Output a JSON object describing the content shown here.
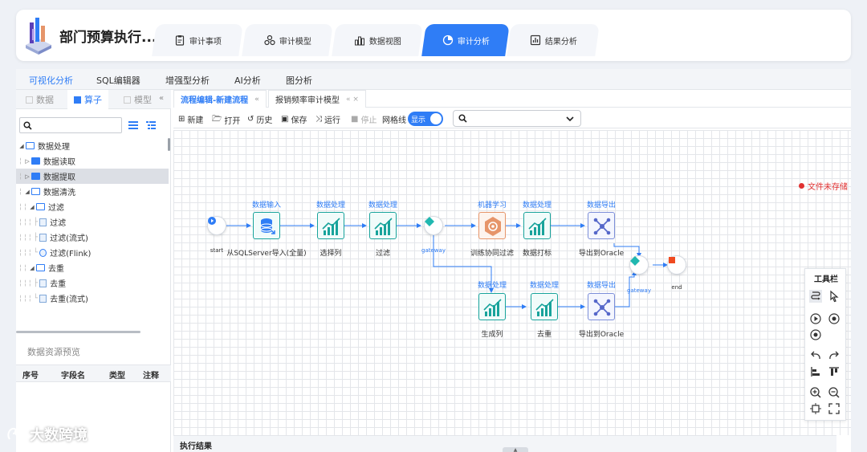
{
  "app": {
    "title": "部门预算执行..."
  },
  "nav_tabs": [
    {
      "label": "审计事项",
      "icon": "clipboard-icon"
    },
    {
      "label": "审计模型",
      "icon": "model-icon"
    },
    {
      "label": "数据视图",
      "icon": "bar-chart-icon"
    },
    {
      "label": "审计分析",
      "icon": "pie-chart-icon",
      "active": true
    },
    {
      "label": "结果分析",
      "icon": "report-icon"
    }
  ],
  "sub_tabs": [
    "可视化分析",
    "SQL编辑器",
    "增强型分析",
    "AI分析",
    "图分析"
  ],
  "left_tabs": [
    "数据",
    "算子",
    "模型"
  ],
  "tree": [
    {
      "label": "数据处理",
      "level": 0,
      "type": "folder-open",
      "expanded": true
    },
    {
      "label": "数据读取",
      "level": 1,
      "type": "folder",
      "expanded": false
    },
    {
      "label": "数据提取",
      "level": 1,
      "type": "folder",
      "expanded": false,
      "selected": true
    },
    {
      "label": "数据清洗",
      "level": 1,
      "type": "folder-open",
      "expanded": true
    },
    {
      "label": "过滤",
      "level": 2,
      "type": "folder-open",
      "expanded": true
    },
    {
      "label": "过滤",
      "level": 3,
      "type": "file"
    },
    {
      "label": "过滤(流式)",
      "level": 3,
      "type": "file"
    },
    {
      "label": "过滤(Flink)",
      "level": 3,
      "type": "flink"
    },
    {
      "label": "去重",
      "level": 2,
      "type": "folder-open",
      "expanded": true
    },
    {
      "label": "去重",
      "level": 3,
      "type": "file"
    },
    {
      "label": "去重(流式)",
      "level": 3,
      "type": "file"
    }
  ],
  "preview": {
    "title": "数据资源预览",
    "columns": [
      "序号",
      "字段名",
      "类型",
      "注释"
    ]
  },
  "editor_tabs": [
    {
      "label": "流程编辑-新建流程",
      "active": true
    },
    {
      "label": "报销频率审计模型",
      "active": false
    }
  ],
  "toolbar": {
    "new": "新建",
    "open": "打开",
    "history": "历史",
    "save": "保存",
    "run": "运行",
    "stop": "停止",
    "grid": "网格线",
    "grid_toggle": "显示"
  },
  "flow": {
    "start_label": "start",
    "end_label": "end",
    "gateway_label": "gateway",
    "unsaved": "文件未存储",
    "nodes": [
      {
        "id": "n1",
        "category": "数据输入",
        "label": "从SQLServer导入(全量)",
        "kind": "db"
      },
      {
        "id": "n2",
        "category": "数据处理",
        "label": "选择列",
        "kind": "proc"
      },
      {
        "id": "n3",
        "category": "数据处理",
        "label": "过滤",
        "kind": "proc"
      },
      {
        "id": "n4",
        "category": "机器学习",
        "label": "训练协同过滤",
        "kind": "ml"
      },
      {
        "id": "n5",
        "category": "数据处理",
        "label": "数据打标",
        "kind": "proc"
      },
      {
        "id": "n6",
        "category": "数据导出",
        "label": "导出到Oracle",
        "kind": "out"
      },
      {
        "id": "n7",
        "category": "数据处理",
        "label": "生成列",
        "kind": "proc"
      },
      {
        "id": "n8",
        "category": "数据处理",
        "label": "去重",
        "kind": "proc"
      },
      {
        "id": "n9",
        "category": "数据导出",
        "label": "导出到Oracle",
        "kind": "out"
      }
    ]
  },
  "toolbox": {
    "title": "工具栏"
  },
  "results": {
    "title": "执行结果"
  },
  "watermark": "大数跨境",
  "colors": {
    "accent": "#2f7df6",
    "node_teal": "#18a39b",
    "node_ml": "#e6956a",
    "node_out": "#7d8fd9",
    "error": "#e03131"
  }
}
